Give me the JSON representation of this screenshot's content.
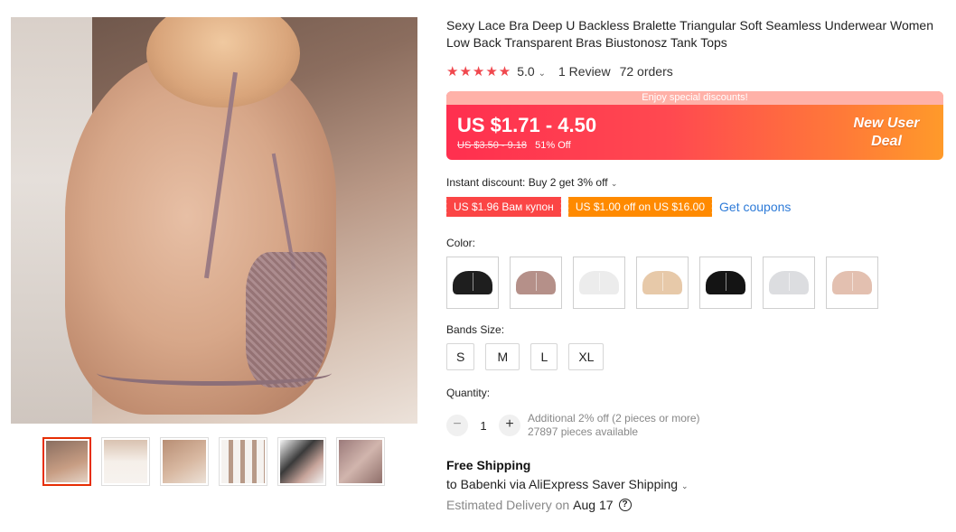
{
  "product": {
    "title": "Sexy Lace Bra Deep U Backless Bralette Triangular Soft Seamless Underwear Women Low Back Transparent Bras Biustonosz Tank Tops",
    "stars": "★★★★★",
    "rating": "5.0",
    "reviews": "1 Review",
    "orders": "72 orders"
  },
  "promo": {
    "banner_text": "Enjoy special discounts!",
    "price": "US $1.71 - 4.50",
    "original_price": "US $3.50 - 9.18",
    "discount": "51% Off",
    "new_user_line1": "New User",
    "new_user_line2": "Deal"
  },
  "instant_discount": "Instant discount: Buy 2 get 3% off",
  "coupons": {
    "coupon1": "US $1.96 Вам купон",
    "coupon2": "US $1.00 off on US $16.00",
    "get_coupons": "Get coupons"
  },
  "color": {
    "label": "Color:",
    "options": [
      {
        "name": "black-lace",
        "color": "#1e1e1e"
      },
      {
        "name": "mauve",
        "color": "#b59089"
      },
      {
        "name": "white",
        "color": "#ececec"
      },
      {
        "name": "nude",
        "color": "#e7c9a9"
      },
      {
        "name": "black",
        "color": "#141414"
      },
      {
        "name": "light-grey",
        "color": "#dcdde0"
      },
      {
        "name": "skin",
        "color": "#e3c0b0"
      }
    ]
  },
  "sizes": {
    "label": "Bands Size:",
    "options": [
      "S",
      "M",
      "L",
      "XL"
    ]
  },
  "quantity": {
    "label": "Quantity:",
    "minus": "−",
    "value": "1",
    "plus": "+",
    "additional": "Additional 2% off (2 pieces or more)",
    "available": "27897 pieces available"
  },
  "shipping": {
    "title": "Free Shipping",
    "destination": "to Babenki via AliExpress Saver Shipping",
    "delivery_label": "Estimated Delivery on",
    "delivery_date": "Aug 17"
  },
  "icons": {
    "chevron": "⌄",
    "help": "?"
  }
}
